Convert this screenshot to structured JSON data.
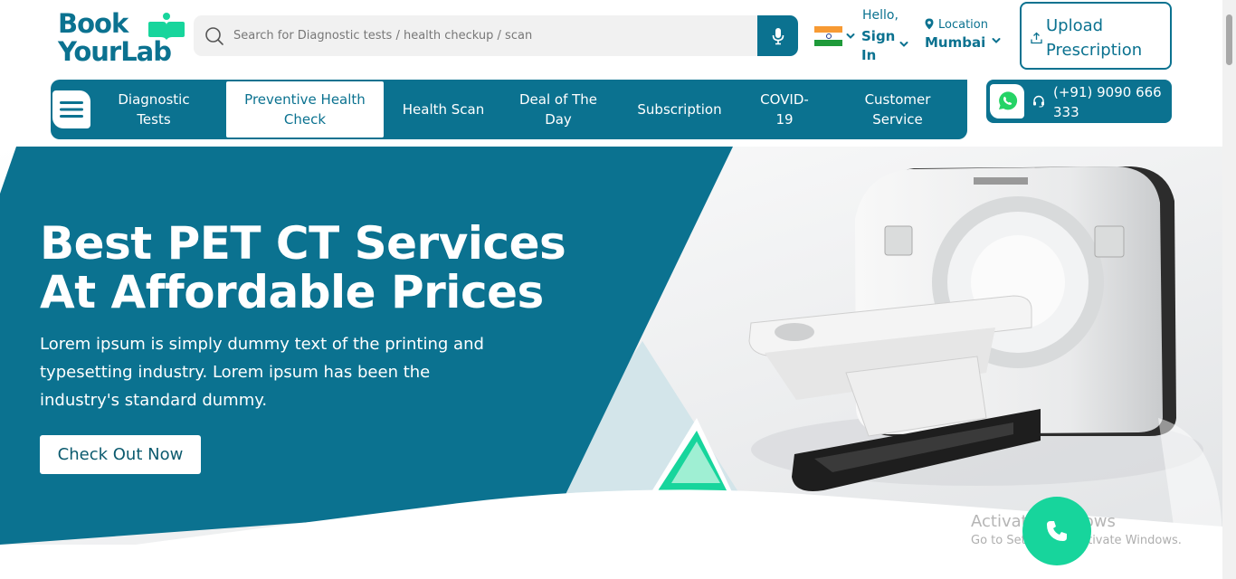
{
  "brand": {
    "line1": "Book",
    "line2": "YourLab"
  },
  "search": {
    "placeholder": "Search for Diagnostic tests / health checkup / scan"
  },
  "account": {
    "greeting": "Hello,",
    "action": "Sign In"
  },
  "location": {
    "label": "Location",
    "city": "Mumbai"
  },
  "upload": {
    "label": "Upload Prescription"
  },
  "nav": {
    "items": [
      {
        "label": "Diagnostic Tests"
      },
      {
        "label": "Preventive Health Check"
      },
      {
        "label": "Health Scan"
      },
      {
        "label": "Deal of The Day"
      },
      {
        "label": "Subscription"
      },
      {
        "label": "COVID-19"
      },
      {
        "label": "Customer Service"
      }
    ]
  },
  "contact": {
    "phone": "(+91) 9090 666 333"
  },
  "hero": {
    "title": "Best PET CT Services At Affordable Prices",
    "description": "Lorem ipsum is simply dummy text of the printing and typesetting industry. Lorem ipsum has been the industry's standard dummy.",
    "cta": "Check Out Now"
  },
  "watermark": {
    "line1": "Activate Windows",
    "line2": "Go to Settings to activate Windows."
  },
  "icons": [
    "search-icon",
    "microphone-icon",
    "india-flag-icon",
    "chevron-down-icon",
    "location-pin-icon",
    "upload-icon",
    "hamburger-menu-icon",
    "whatsapp-icon",
    "headset-icon",
    "phone-icon"
  ],
  "colors": {
    "primary": "#0b7290",
    "accent": "#17d59c",
    "whatsapp": "#25d366"
  }
}
